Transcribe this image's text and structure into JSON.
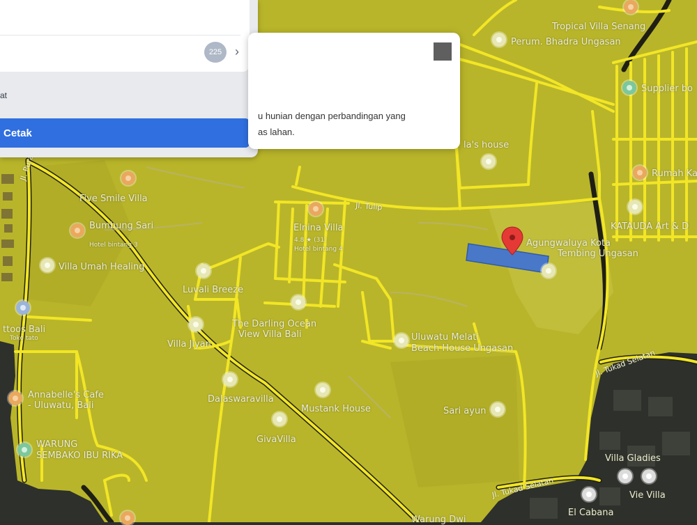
{
  "map": {
    "colors": {
      "overlay": "#bdb92b",
      "road": "#f2e626",
      "road_outline": "#1c1c10",
      "parcel": "#4a78c8",
      "marker": "#e53935"
    },
    "places": [
      {
        "name": "Tropical Villa Senang",
        "icon": "place-pin-icon"
      },
      {
        "name": "Perum. Bhadra Ungasan",
        "icon": "place-pin-icon"
      },
      {
        "name": "Supplier bo",
        "icon": "place-pin-icon"
      },
      {
        "name": "Rumah Ka",
        "icon": "place-pin-icon"
      },
      {
        "name": "KATAUDA Art & D",
        "icon": "place-pin-icon"
      },
      {
        "name": "la's house",
        "icon": "place-pin-icon"
      },
      {
        "name": "Five Smile Villa",
        "icon": "hotel-pin-icon"
      },
      {
        "name": "Bumbung Sari",
        "icon": "hotel-pin-icon"
      },
      {
        "name": "Hotel bintang 3",
        "icon": ""
      },
      {
        "name": "Villa Umah Healing",
        "icon": "place-pin-icon"
      },
      {
        "name": "Elnina Villa",
        "icon": "hotel-pin-icon"
      },
      {
        "name": "4.8 ★ (31)",
        "icon": ""
      },
      {
        "name": "Hotel bintang 4",
        "icon": ""
      },
      {
        "name": "Luvali Breeze",
        "icon": "place-pin-icon"
      },
      {
        "name": "The Darling Ocean",
        "icon": ""
      },
      {
        "name": "View Villa Bali",
        "icon": ""
      },
      {
        "name": "Villa Jiyan",
        "icon": "place-pin-icon"
      },
      {
        "name": "Uluwatu Melati",
        "icon": "place-pin-icon"
      },
      {
        "name": "Beach House Ungasan",
        "icon": ""
      },
      {
        "name": "Agungwaluya Kota",
        "icon": "place-pin-icon"
      },
      {
        "name": "Tembing Ungasan",
        "icon": ""
      },
      {
        "name": "ttoos Bali",
        "icon": "shop-pin-icon"
      },
      {
        "name": "Toko tato",
        "icon": ""
      },
      {
        "name": "Annabelle's Cafe",
        "icon": "food-pin-icon"
      },
      {
        "name": "- Uluwatu, Bali",
        "icon": ""
      },
      {
        "name": "WARUNG",
        "icon": "grocery-pin-icon"
      },
      {
        "name": "SEMBAKO IBU RIKA",
        "icon": ""
      },
      {
        "name": "Dalaswaravilla",
        "icon": "place-pin-icon"
      },
      {
        "name": "Mustank House",
        "icon": "place-pin-icon"
      },
      {
        "name": "Sari ayun",
        "icon": "place-pin-icon"
      },
      {
        "name": "GivaVilla",
        "icon": "place-pin-icon"
      },
      {
        "name": "Villa Gladies",
        "icon": "place-pin-icon"
      },
      {
        "name": "Vie Villa",
        "icon": "place-pin-icon"
      },
      {
        "name": "El Cabana",
        "icon": "place-pin-icon"
      },
      {
        "name": "Warung Dwi",
        "icon": ""
      }
    ],
    "roads": [
      "Jl. Tulip",
      "Jl. Tukad Selatan",
      "Jl. Tukad Selatan",
      "Jl. Pura"
    ],
    "marker_icon": "location-marker-icon"
  },
  "left_panel": {
    "count_badge": "225",
    "chevron_icon": "chevron-right-icon",
    "small_text": "at",
    "print_button_label": "Cetak"
  },
  "info_popup": {
    "close_icon": "close-square-icon",
    "line1": "u hunian dengan perbandingan yang",
    "line2": "as lahan."
  }
}
